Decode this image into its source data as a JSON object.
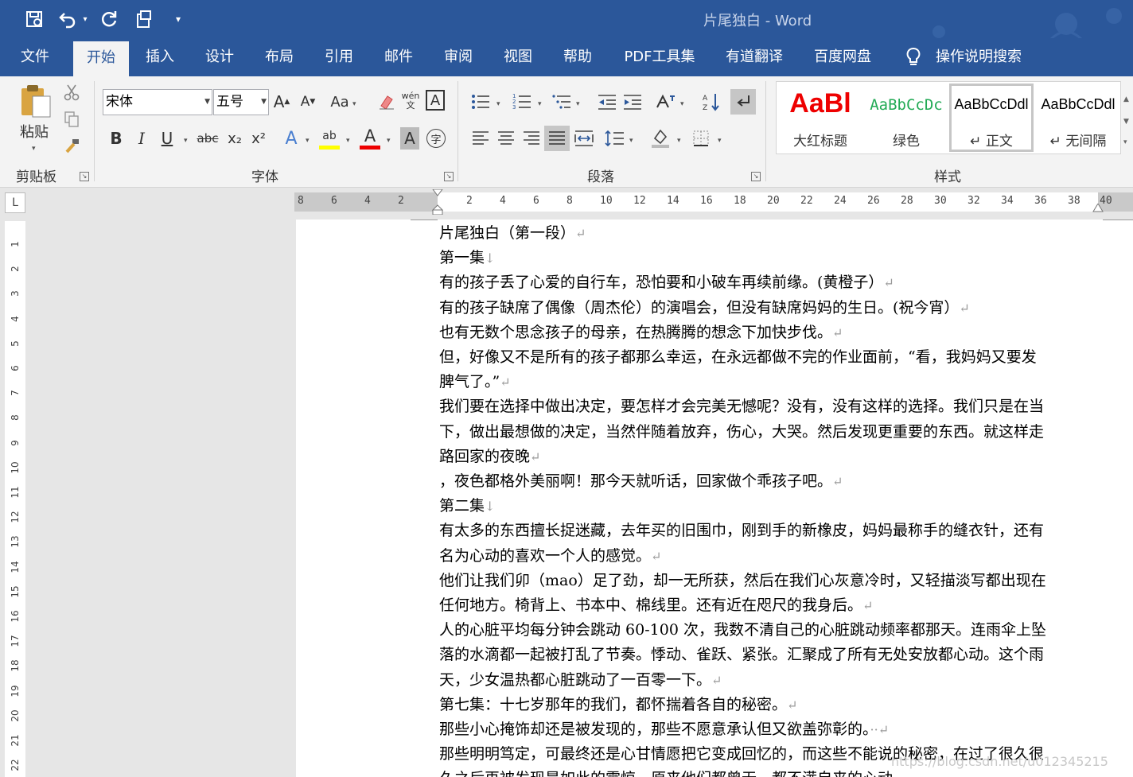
{
  "titlebar": {
    "title": "片尾独白 - Word",
    "save_icon": "save-icon",
    "undo_icon": "undo-icon",
    "redo_icon": "redo-icon",
    "touch_icon": "touch-mode-icon",
    "customize_icon": "customize-qat-icon"
  },
  "tabs": [
    "文件",
    "开始",
    "插入",
    "设计",
    "布局",
    "引用",
    "邮件",
    "审阅",
    "视图",
    "帮助",
    "PDF工具集",
    "有道翻译",
    "百度网盘",
    "操作说明搜索"
  ],
  "active_tab": "开始",
  "clipboard": {
    "paste_label": "粘贴",
    "group_label": "剪贴板"
  },
  "font": {
    "name": "宋体",
    "size": "五号",
    "change_case": "Aa",
    "phonetic": "wén\n文",
    "border": "A",
    "bold": "B",
    "italic": "I",
    "underline": "U",
    "strike": "abc",
    "sub": "x₂",
    "sup": "x²",
    "text_effect": "A",
    "highlight": "ab",
    "font_color": "A",
    "shading": "A",
    "enclosed": "字",
    "group_label": "字体"
  },
  "paragraph": {
    "group_label": "段落"
  },
  "styles": {
    "group_label": "样式",
    "items": [
      {
        "sample": "AaBl",
        "name": "大红标题"
      },
      {
        "sample": "AaBbCcDc",
        "name": "绿色"
      },
      {
        "sample": "AaBbCcDdl",
        "name": "↵ 正文"
      },
      {
        "sample": "AaBbCcDdl",
        "name": "↵ 无间隔"
      }
    ]
  },
  "ruler": {
    "h_labels": [
      "8",
      "6",
      "4",
      "2",
      "2",
      "4",
      "6",
      "8",
      "10",
      "12",
      "14",
      "16",
      "18",
      "20",
      "22",
      "24",
      "26",
      "28",
      "30",
      "32",
      "34",
      "36",
      "38",
      "40"
    ],
    "v_labels": [
      "1",
      "2",
      "3",
      "4",
      "5",
      "6",
      "7",
      "8",
      "9",
      "10",
      "11",
      "12",
      "13",
      "14",
      "15",
      "16",
      "17",
      "18",
      "19",
      "20",
      "21",
      "22"
    ]
  },
  "document": {
    "lines": [
      {
        "text": "片尾独白（第一段）",
        "mark": "↵"
      },
      {
        "text": "第一集",
        "mark": "↓"
      },
      {
        "text": "有的孩子丢了心爱的自行车，恐怕要和小破车再续前缘。(黄橙子）",
        "mark": "↵"
      },
      {
        "text": "有的孩子缺席了偶像（周杰伦）的演唱会，但没有缺席妈妈的生日。(祝今宵）",
        "mark": "↵"
      },
      {
        "text": "也有无数个思念孩子的母亲，在热腾腾的想念下加快步伐。",
        "mark": "↵"
      },
      {
        "text": "但，好像又不是所有的孩子都那么幸运，在永远都做不完的作业面前，“看，我妈妈又要发",
        "mark": ""
      },
      {
        "text": "脾气了。”",
        "mark": "↵"
      },
      {
        "text": "我们要在选择中做出决定，要怎样才会完美无憾呢？没有，没有这样的选择。我们只是在当",
        "mark": ""
      },
      {
        "text": "下，做出最想做的决定，当然伴随着放弃，伤心，大哭。然后发现更重要的东西。就这样走",
        "mark": ""
      },
      {
        "text": "路回家的夜晚",
        "mark": "↵"
      },
      {
        "text": "，夜色都格外美丽啊！那今天就听话，回家做个乖孩子吧。",
        "mark": "↵"
      },
      {
        "text": "第二集",
        "mark": "↓"
      },
      {
        "text": "有太多的东西擅长捉迷藏，去年买的旧围巾，刚到手的新橡皮，妈妈最称手的缝衣针，还有",
        "mark": ""
      },
      {
        "text": "名为心动的喜欢一个人的感觉。",
        "mark": "↵"
      },
      {
        "text": "他们让我们卯（mao）足了劲，却一无所获，然后在我们心灰意冷时，又轻描淡写都出现在",
        "mark": ""
      },
      {
        "text": "任何地方。椅背上、书本中、棉线里。还有近在咫尺的我身后。",
        "mark": "↵"
      },
      {
        "text": "人的心脏平均每分钟会跳动 60-100 次，我数不清自己的心脏跳动频率都那天。连雨伞上坠",
        "mark": ""
      },
      {
        "text": "落的水滴都一起被打乱了节奏。悸动、雀跃、紧张。汇聚成了所有无处安放都心动。这个雨",
        "mark": ""
      },
      {
        "text": "天，少女温热都心脏跳动了一百零一下。",
        "mark": "↵"
      },
      {
        "text": "第七集：十七岁那年的我们，都怀揣着各自的秘密。",
        "mark": "↵"
      },
      {
        "text": "那些小心掩饰却还是被发现的，那些不愿意承认但又欲盖弥彰的。",
        "mark": "··↵"
      },
      {
        "text": "那些明明笃定，可最终还是心甘情愿把它变成回忆的，而这些不能说的秘密，在过了很久很",
        "mark": ""
      },
      {
        "text": "久之后再被发现是如此的震惊，原来他们都曾无一都不满自来的心动",
        "mark": ""
      }
    ]
  },
  "watermark": "https://blog.csdn.net/u012345215"
}
